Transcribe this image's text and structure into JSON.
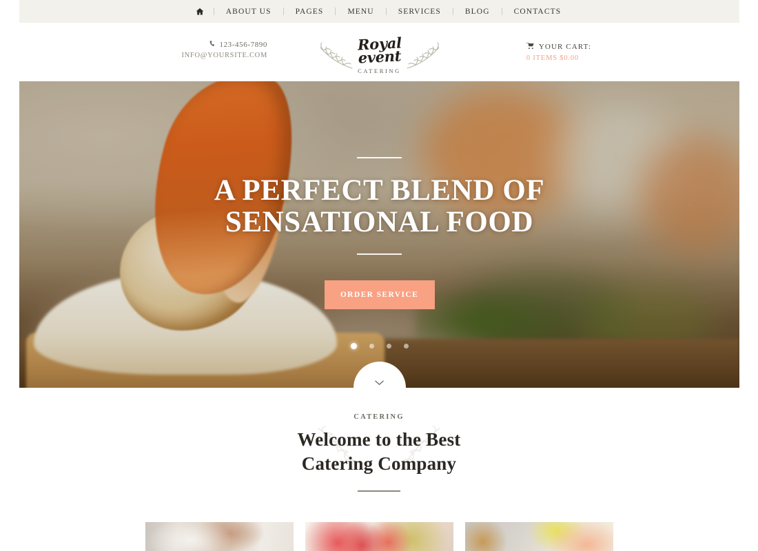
{
  "topnav": {
    "home_icon": "home-icon",
    "items": [
      "ABOUT US",
      "PAGES",
      "MENU",
      "SERVICES",
      "BLOG",
      "CONTACTS"
    ]
  },
  "header": {
    "phone_icon": "phone-icon",
    "phone": "123-456-7890",
    "email": "INFO@YOURSITE.COM",
    "logo": {
      "line1": "Royal",
      "line2": "event",
      "tagline": "CATERING",
      "decor": "laurel-branch"
    },
    "cart": {
      "icon": "shopping-cart-icon",
      "label": "YOUR CART:",
      "summary": "0 ITEMS $0.00",
      "accent_color": "#f6a287"
    }
  },
  "hero": {
    "title_line1": "A PERFECT BLEND OF",
    "title_line2": "SENSATIONAL FOOD",
    "button_label": "ORDER SERVICE",
    "button_color": "#f9a183",
    "slides": 4,
    "active_slide": 1,
    "scroll_icon": "chevron-down-icon",
    "image_alt": "close-up of grilled shrimp and scallop on a cracker with cream, on a wooden board"
  },
  "welcome": {
    "label": "CATERING",
    "title_line1": "Welcome to the Best",
    "title_line2": "Catering Company",
    "decor": "laurel-wreath"
  },
  "cards": [
    {
      "alt": "chef in white hat preparing food"
    },
    {
      "alt": "red canapes with garnish skewers"
    },
    {
      "alt": "wicker basket with light appetizers"
    }
  ]
}
